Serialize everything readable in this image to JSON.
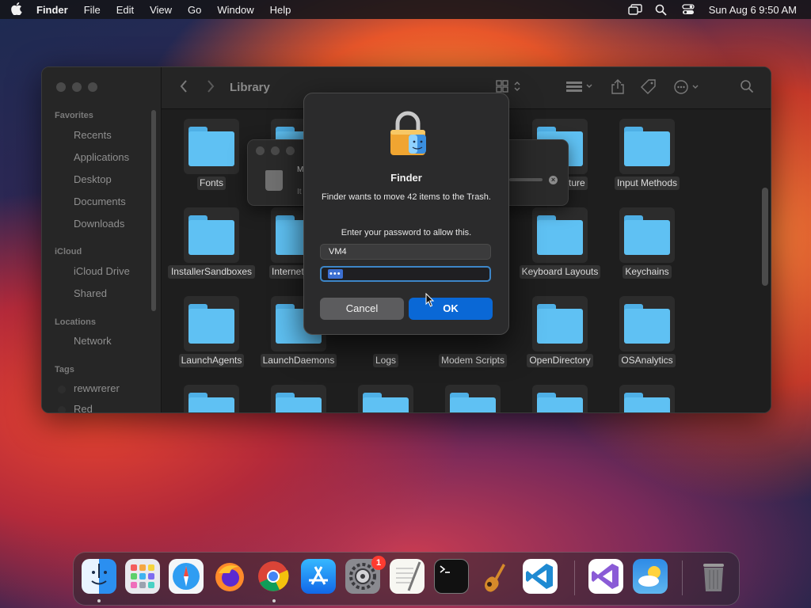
{
  "menubar": {
    "app_name": "Finder",
    "items": [
      "File",
      "Edit",
      "View",
      "Go",
      "Window",
      "Help"
    ],
    "datetime": "Sun Aug 6  9:50 AM"
  },
  "finder": {
    "title": "Library",
    "sidebar": {
      "favorites_header": "Favorites",
      "favorites": [
        "Recents",
        "Applications",
        "Desktop",
        "Documents",
        "Downloads"
      ],
      "icloud_header": "iCloud",
      "icloud": [
        "iCloud Drive",
        "Shared"
      ],
      "locations_header": "Locations",
      "locations": [
        "Network"
      ],
      "tags_header": "Tags",
      "tags": [
        "rewwrerer",
        "Red"
      ]
    },
    "folders": [
      {
        "label": "Fonts"
      },
      {
        "label": ""
      },
      {
        "label": ""
      },
      {
        "label": ""
      },
      {
        "label": "pture"
      },
      {
        "label": "Input Methods"
      },
      {
        "label": "InstallerSandboxes"
      },
      {
        "label": "Internet P"
      },
      {
        "label": ""
      },
      {
        "label": "s"
      },
      {
        "label": "Keyboard Layouts"
      },
      {
        "label": "Keychains"
      },
      {
        "label": "LaunchAgents"
      },
      {
        "label": "LaunchDaemons"
      },
      {
        "label": "Logs"
      },
      {
        "label": "Modem Scripts"
      },
      {
        "label": "OpenDirectory"
      },
      {
        "label": "OSAnalytics"
      }
    ]
  },
  "progress_panel": {
    "line1": "M",
    "line2": "It"
  },
  "dialog": {
    "title": "Finder",
    "message": "Finder wants to move 42 items to the Trash.",
    "prompt": "Enter your password to allow this.",
    "username": "VM4",
    "password_mask": "•••",
    "cancel_label": "Cancel",
    "ok_label": "OK"
  },
  "dock": {
    "apps": [
      "Finder",
      "Launchpad",
      "Safari",
      "Firefox",
      "Chrome",
      "App Store",
      "System Settings",
      "TextEdit",
      "Terminal",
      "GarageBand",
      "Visual Studio Code",
      "Visual Studio",
      "Weather",
      "Trash"
    ],
    "settings_badge": "1"
  },
  "colors": {
    "accent": "#0a68d6",
    "folder": "#5fc1f3",
    "badge": "#ff3b30"
  }
}
